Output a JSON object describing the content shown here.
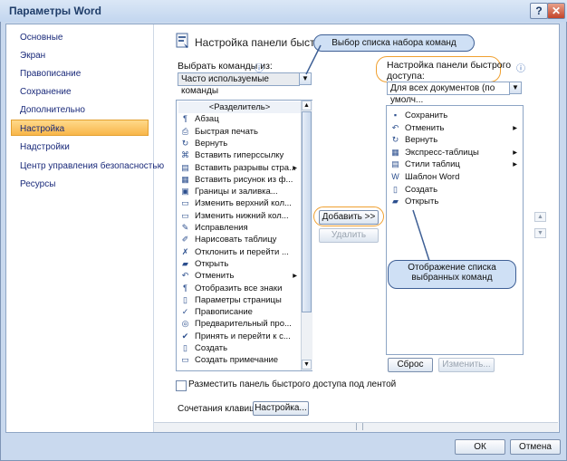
{
  "window": {
    "title": "Параметры Word",
    "help_label": "?",
    "close_label": "✕"
  },
  "sidebar": {
    "items": [
      {
        "label": "Основные"
      },
      {
        "label": "Экран"
      },
      {
        "label": "Правописание"
      },
      {
        "label": "Сохранение"
      },
      {
        "label": "Дополнительно"
      },
      {
        "label": "Настройка"
      },
      {
        "label": "Надстройки"
      },
      {
        "label": "Центр управления безопасностью"
      },
      {
        "label": "Ресурсы"
      }
    ],
    "selected": "Настройка"
  },
  "header": {
    "title": "Настройка панели быстрого"
  },
  "choose": {
    "label": "Выбрать команды из:",
    "value": "Часто используемые команды"
  },
  "qat": {
    "label_line1": "Настройка панели быстрого",
    "label_line2": "доступа:",
    "value": "Для всех документов (по умолч..."
  },
  "commands": [
    {
      "label": "<Разделитель>",
      "icon": ""
    },
    {
      "label": "Абзац",
      "icon": "¶"
    },
    {
      "label": "Быстрая печать",
      "icon": "⎙"
    },
    {
      "label": "Вернуть",
      "icon": "↻"
    },
    {
      "label": "Вставить гиперссылку",
      "icon": "⌘"
    },
    {
      "label": "Вставить разрывы стра...",
      "icon": "▤",
      "sub": "▸"
    },
    {
      "label": "Вставить рисунок из ф...",
      "icon": "▦"
    },
    {
      "label": "Границы и заливка...",
      "icon": "▣"
    },
    {
      "label": "Изменить верхний кол...",
      "icon": "▭"
    },
    {
      "label": "Изменить нижний кол...",
      "icon": "▭"
    },
    {
      "label": "Исправления",
      "icon": "✎"
    },
    {
      "label": "Нарисовать таблицу",
      "icon": "✐"
    },
    {
      "label": "Отклонить и перейти ...",
      "icon": "✗"
    },
    {
      "label": "Открыть",
      "icon": "▰"
    },
    {
      "label": "Отменить",
      "icon": "↶",
      "sub": "▸"
    },
    {
      "label": "Отобразить все знаки",
      "icon": "¶"
    },
    {
      "label": "Параметры страницы",
      "icon": "▯"
    },
    {
      "label": "Правописание",
      "icon": "✓"
    },
    {
      "label": "Предварительный про...",
      "icon": "◎"
    },
    {
      "label": "Принять и перейти к с...",
      "icon": "✔"
    },
    {
      "label": "Создать",
      "icon": "▯"
    },
    {
      "label": "Создать примечание",
      "icon": "▭"
    }
  ],
  "selected_commands": [
    {
      "label": "Сохранить",
      "icon": "▪"
    },
    {
      "label": "Отменить",
      "icon": "↶",
      "sub": "▸"
    },
    {
      "label": "Вернуть",
      "icon": "↻"
    },
    {
      "label": "Экспресс-таблицы",
      "icon": "▦",
      "sub": "▸"
    },
    {
      "label": "Стили таблиц",
      "icon": "▤",
      "sub": "▸"
    },
    {
      "label": "Шаблон Word",
      "icon": "W"
    },
    {
      "label": "Создать",
      "icon": "▯"
    },
    {
      "label": "Открыть",
      "icon": "▰"
    }
  ],
  "buttons": {
    "add": "Добавить >>",
    "remove": "Удалить",
    "reset": "Сброс",
    "modify": "Изменить...",
    "customize": "Настройка...",
    "ok": "ОК",
    "cancel": "Отмена"
  },
  "checkbox": {
    "label": "Разместить панель быстрого доступа под лентой",
    "checked": false
  },
  "shortcuts": {
    "label": "Сочетания клавиш:"
  },
  "callouts": {
    "top": "Выбор списка набора команд",
    "bottom_line1": "Отображение списка",
    "bottom_line2": "выбранных команд"
  },
  "icons": {
    "info": "ⓘ",
    "dropdown": "▼",
    "up": "▲",
    "down": "▼",
    "submenu": "▸"
  }
}
